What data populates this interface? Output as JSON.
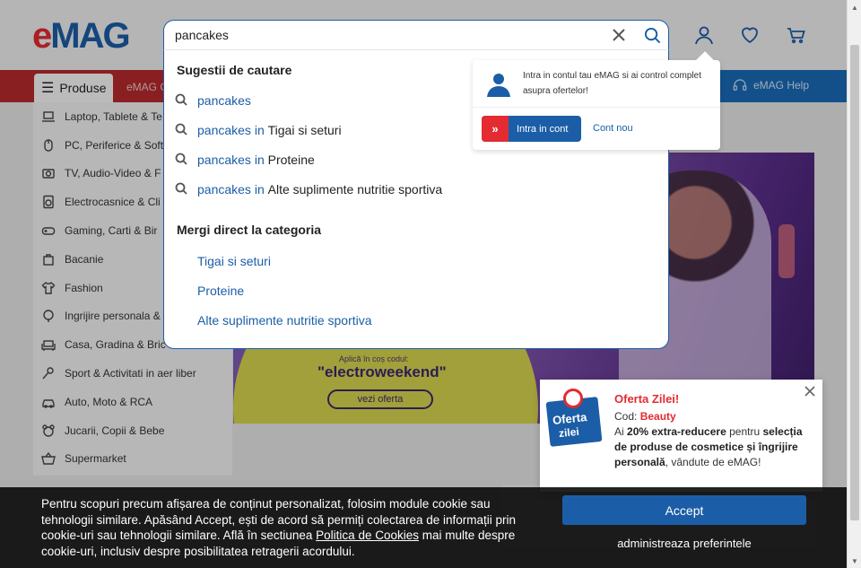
{
  "logo": {
    "e": "e",
    "rest": "MAG"
  },
  "nav": {
    "produse_label": "Produse",
    "partial_link": "eMAG G",
    "help_label": "eMAG Help"
  },
  "categories": [
    {
      "label": "Laptop, Tablete & Te",
      "icon": "laptop-icon"
    },
    {
      "label": "PC, Periferice & Soft",
      "icon": "mouse-icon"
    },
    {
      "label": "TV, Audio-Video & F",
      "icon": "camera-icon"
    },
    {
      "label": "Electrocasnice & Cli",
      "icon": "washer-icon"
    },
    {
      "label": "Gaming, Carti & Bir",
      "icon": "gamepad-icon"
    },
    {
      "label": "Bacanie",
      "icon": "bag-icon"
    },
    {
      "label": "Fashion",
      "icon": "shirt-icon"
    },
    {
      "label": "Ingrijire personala &",
      "icon": "care-icon"
    },
    {
      "label": "Casa, Gradina & Bric",
      "icon": "sofa-icon"
    },
    {
      "label": "Sport & Activitati in aer liber",
      "icon": "sport-icon"
    },
    {
      "label": "Auto, Moto & RCA",
      "icon": "car-icon"
    },
    {
      "label": "Jucarii, Copii & Bebe",
      "icon": "toy-icon"
    },
    {
      "label": "Supermarket",
      "icon": "basket-icon"
    }
  ],
  "search": {
    "value": "pancakes",
    "suggestions_heading": "Sugestii de cautare",
    "suggestions": [
      {
        "term": "pancakes",
        "in": "",
        "context": ""
      },
      {
        "term": "pancakes",
        "in": "in",
        "context": "Tigai si seturi"
      },
      {
        "term": "pancakes",
        "in": "in",
        "context": "Proteine"
      },
      {
        "term": "pancakes",
        "in": "in",
        "context": "Alte suplimente nutritie sportiva"
      }
    ],
    "categories_heading": "Mergi direct la categoria",
    "category_links": [
      "Tigai si seturi",
      "Proteine",
      "Alte suplimente nutritie sportiva"
    ]
  },
  "account_popup": {
    "message": "Intra in contul tau eMAG si ai control complet asupra ofertelor!",
    "login_label": "Intra in cont",
    "register_label": "Cont nou"
  },
  "banner": {
    "aplica": "Aplică în coș codul:",
    "code": "\"electroweekend\"",
    "cta": "vezi oferta"
  },
  "offer": {
    "badge_line1": "Oferta",
    "badge_line2": "zilei",
    "title": "Oferta Zilei!",
    "code_label": "Cod:",
    "code_value": "Beauty",
    "desc_pre": "Ai",
    "desc_pct": "20% extra-reducere",
    "desc_mid": "pentru",
    "desc_sel": "selecția de produse de cosmetice și îngrijire personală",
    "desc_post": ", vândute de eMAG!"
  },
  "cookie": {
    "text_before": "Pentru scopuri precum afișarea de conținut personalizat, folosim module cookie sau tehnologii similare. Apăsând Accept, ești de acord să permiți colectarea de informații prin cookie-uri sau tehnologii similare. Află în sectiunea ",
    "link": "Politica de Cookies",
    "text_after": " mai multe despre cookie-uri, inclusiv despre posibilitatea retragerii acordului.",
    "accept_label": "Accept",
    "prefs_label": "administreaza preferintele"
  },
  "colors": {
    "brand_blue": "#1b5ea7",
    "brand_red": "#e32b31"
  }
}
